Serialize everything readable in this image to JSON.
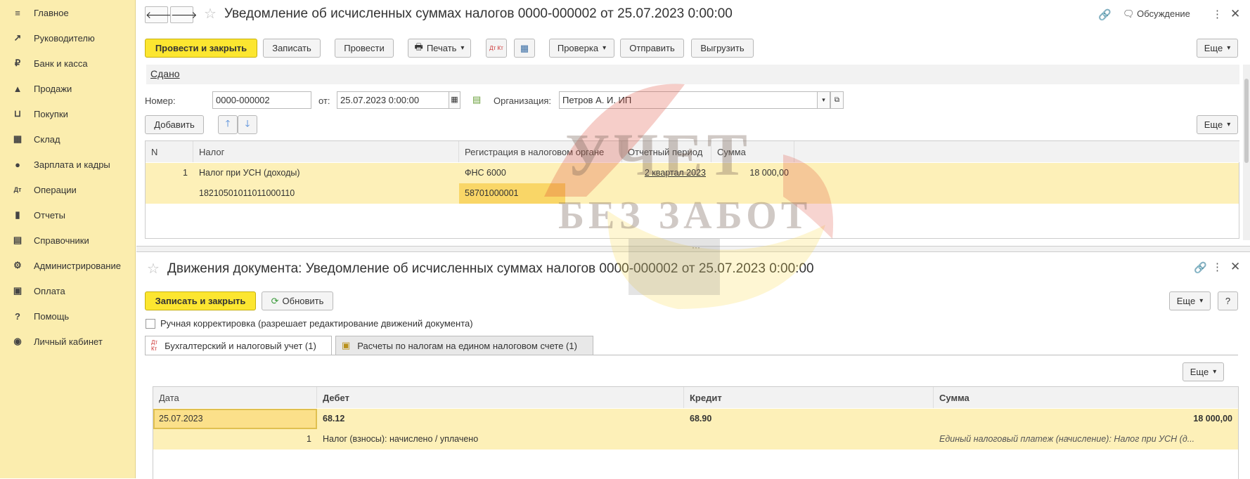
{
  "sidebar": {
    "items": [
      {
        "icon": "≡",
        "label": "Главное"
      },
      {
        "icon": "↗",
        "label": "Руководителю"
      },
      {
        "icon": "₽",
        "label": "Банк и касса"
      },
      {
        "icon": "▲",
        "label": "Продажи"
      },
      {
        "icon": "⊔",
        "label": "Покупки"
      },
      {
        "icon": "▦",
        "label": "Склад"
      },
      {
        "icon": "●",
        "label": "Зарплата и кадры"
      },
      {
        "icon": "Дт",
        "label": "Операции"
      },
      {
        "icon": "▮",
        "label": "Отчеты"
      },
      {
        "icon": "▤",
        "label": "Справочники"
      },
      {
        "icon": "⚙",
        "label": "Администрирование"
      },
      {
        "icon": "▣",
        "label": "Оплата"
      },
      {
        "icon": "?",
        "label": "Помощь"
      },
      {
        "icon": "◉",
        "label": "Личный кабинет"
      }
    ]
  },
  "doc": {
    "title": "Уведомление об исчисленных суммах налогов 0000-000002 от 25.07.2023 0:00:00",
    "discussion": "Обсуждение",
    "toolbar": {
      "post_close": "Провести и закрыть",
      "save": "Записать",
      "post": "Провести",
      "print": "Печать",
      "dtkt": "Дт Кт",
      "check": "Проверка",
      "send": "Отправить",
      "export": "Выгрузить",
      "more": "Еще"
    },
    "status": "Сдано",
    "number_label": "Номер:",
    "number_value": "0000-000002",
    "date_label": "от:",
    "date_value": "25.07.2023  0:00:00",
    "org_label": "Организация:",
    "org_value": "Петров А. И. ИП",
    "add": "Добавить",
    "more2": "Еще",
    "table": {
      "headers": [
        "N",
        "Налог",
        "Регистрация в налоговом органе",
        "Отчетный период",
        "Сумма"
      ],
      "rows": [
        {
          "n": "1",
          "tax": "Налог при УСН (доходы)",
          "kbk": "18210501011011000110",
          "reg": "ФНС 6000",
          "oktmo": "58701000001",
          "period": "2 квартал 2023",
          "sum": "18 000,00"
        }
      ]
    }
  },
  "movements": {
    "title": "Движения документа: Уведомление об исчисленных суммах налогов 0000-000002 от 25.07.2023 0:00:00",
    "save_close": "Записать и закрыть",
    "refresh": "Обновить",
    "more": "Еще",
    "help": "?",
    "manual_label": "Ручная корректировка (разрешает редактирование движений документа)",
    "tabs": [
      {
        "label": "Бухгалтерский и налоговый учет (1)"
      },
      {
        "label": "Расчеты по налогам на едином налоговом счете (1)"
      }
    ],
    "more3": "Еще",
    "table": {
      "headers": [
        "Дата",
        "Дебет",
        "Кредит",
        "Сумма"
      ],
      "rows": [
        {
          "date": "25.07.2023",
          "n": "1",
          "debit": "68.12",
          "debit_sub": "Налог (взносы): начислено / уплачено",
          "credit": "68.90",
          "sum": "18 000,00",
          "content": "Единый налоговый платеж (начисление): Налог при УСН (д..."
        }
      ]
    }
  },
  "watermark": {
    "line1": "УЧЕТ",
    "line2": "БЕЗ ЗАБОТ"
  },
  "colors": {
    "sidebar": "#fbedae",
    "primary_button": "#fce630",
    "row_highlight": "#fdf0b8"
  }
}
